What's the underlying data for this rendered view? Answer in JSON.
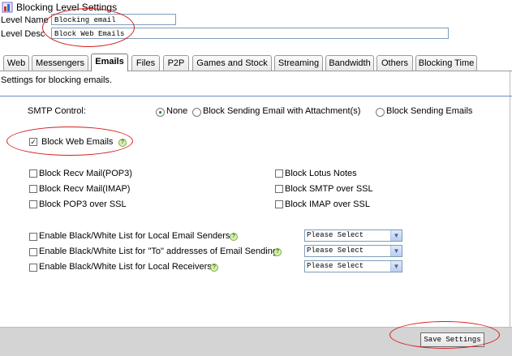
{
  "window": {
    "title": "Blocking Level Settings",
    "icon": "shield-icon"
  },
  "level": {
    "name_label": "Level Name",
    "name_value": "Blocking email",
    "desc_label": "Level Desc",
    "desc_value": "Block Web Emails"
  },
  "tabs": [
    {
      "label": "Web"
    },
    {
      "label": "Messengers"
    },
    {
      "label": "Emails",
      "active": true
    },
    {
      "label": "Files"
    },
    {
      "label": "P2P"
    },
    {
      "label": "Games and Stock"
    },
    {
      "label": "Streaming"
    },
    {
      "label": "Bandwidth"
    },
    {
      "label": "Others"
    },
    {
      "label": "Blocking Time"
    }
  ],
  "panel": {
    "subtitle": "Settings for blocking emails.",
    "smtp_label": "SMTP Control:",
    "smtp_options": [
      {
        "label": "None",
        "selected": true
      },
      {
        "label": "Block Sending Email with Attachment(s)",
        "selected": false
      },
      {
        "label": "Block Sending Emails",
        "selected": false
      }
    ],
    "block_web_emails": {
      "label": "Block Web Emails",
      "checked": true
    },
    "left_options": [
      {
        "label": "Block Recv Mail(POP3)",
        "checked": false
      },
      {
        "label": "Block Recv Mail(IMAP)",
        "checked": false
      },
      {
        "label": "Block POP3 over SSL",
        "checked": false
      }
    ],
    "right_options": [
      {
        "label": "Block Lotus Notes",
        "checked": false
      },
      {
        "label": "Block SMTP over SSL",
        "checked": false
      },
      {
        "label": "Block IMAP over SSL",
        "checked": false
      }
    ],
    "lists": [
      {
        "label": "Enable Black/White List for Local Email Senders",
        "checked": false,
        "select": "Please Select"
      },
      {
        "label": "Enable Black/White List for \"To\" addresses of Email Sending",
        "checked": false,
        "select": "Please Select"
      },
      {
        "label": "Enable Black/White List for Local Receivers",
        "checked": false,
        "select": "Please Select"
      }
    ]
  },
  "footer": {
    "save_label": "Save Settings"
  },
  "colors": {
    "annotation": "#d41e1e",
    "divider": "#6a8fc0",
    "footer": "#d4d4d4"
  }
}
